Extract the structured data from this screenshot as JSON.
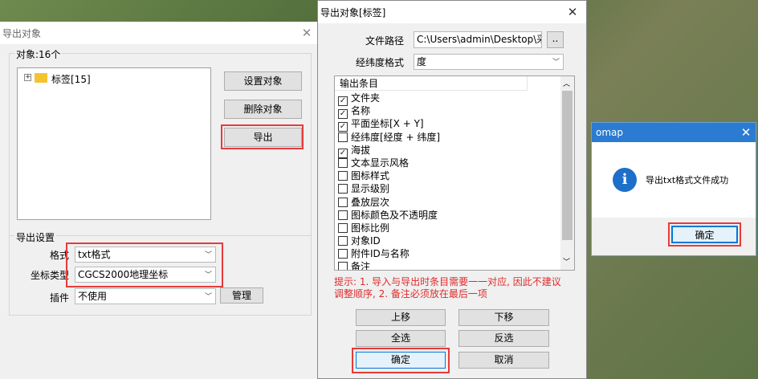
{
  "left": {
    "title": "导出对象",
    "objects_label": "对象:16个",
    "tree_item": "标签[15]",
    "btn_set": "设置对象",
    "btn_delete": "删除对象",
    "btn_export": "导出",
    "settings_title": "导出设置",
    "format_label": "格式",
    "format_value": "txt格式",
    "coord_label": "坐标类型",
    "coord_value": "CGCS2000地理坐标",
    "plugin_label": "插件",
    "plugin_value": "不使用",
    "btn_manage": "管理"
  },
  "middle": {
    "title": "导出对象[标签]",
    "path_label": "文件路径",
    "path_value": "C:\\Users\\admin\\Desktop\\采集",
    "browse_label": "..",
    "latlon_label": "经纬度格式",
    "latlon_value": "度",
    "list_header": "输出条目",
    "items": [
      {
        "label": "文件夹",
        "checked": true
      },
      {
        "label": "名称",
        "checked": true
      },
      {
        "label": "平面坐标[X + Y]",
        "checked": true
      },
      {
        "label": "经纬度[经度 + 纬度]",
        "checked": false
      },
      {
        "label": "海拔",
        "checked": true
      },
      {
        "label": "文本显示风格",
        "checked": false
      },
      {
        "label": "图标样式",
        "checked": false
      },
      {
        "label": "显示级别",
        "checked": false
      },
      {
        "label": "叠放层次",
        "checked": false
      },
      {
        "label": "图标颜色及不透明度",
        "checked": false
      },
      {
        "label": "图标比例",
        "checked": false
      },
      {
        "label": "对象ID",
        "checked": false
      },
      {
        "label": "附件ID与名称",
        "checked": false
      },
      {
        "label": "备注",
        "checked": false
      }
    ],
    "hint_line1": "提示: 1. 导入与导出时条目需要一一对应, 因此不建议",
    "hint_line2": "调整顺序, 2. 备注必须放在最后一项",
    "btn_up": "上移",
    "btn_down": "下移",
    "btn_selectall": "全选",
    "btn_invert": "反选",
    "btn_ok": "确定",
    "btn_cancel": "取消"
  },
  "dialog": {
    "title": "omap",
    "message": "导出txt格式文件成功",
    "btn_ok": "确定",
    "icon": "info-icon"
  },
  "colors": {
    "highlight": "#e83a3a",
    "info_blue": "#1e6fc9",
    "hint_red": "#e02a2a"
  }
}
